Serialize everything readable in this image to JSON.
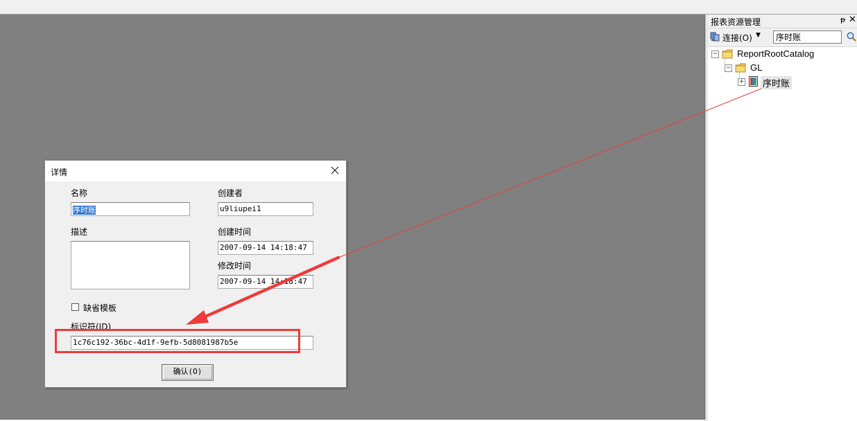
{
  "panel": {
    "title": "报表资源管理",
    "pin_glyph": "ᵽ",
    "close_glyph": "✕",
    "connect_label": "连接(O)",
    "search_value": "序时账",
    "tree": {
      "root": "ReportRootCatalog",
      "folder": "GL",
      "report": "序时账"
    }
  },
  "dialog": {
    "title": "详情",
    "name_label": "名称",
    "name_value": "序时账",
    "creator_label": "创建者",
    "creator_value": "u9liupei1",
    "desc_label": "描述",
    "created_label": "创建时间",
    "created_value": "2007-09-14 14:18:47",
    "modified_label": "修改时间",
    "modified_value": "2007-09-14 14:18:47",
    "default_template_label": "缺省模板",
    "id_label": "标识符(ID)",
    "id_value": "1c76c192-36bc-4d1f-9efb-5d8081987b5e",
    "confirm_label": "确认(O)"
  },
  "colors": {
    "workspace": "#808080",
    "annotation": "#ee3b3b",
    "selection": "#3077d0"
  },
  "icons": [
    "pin-icon",
    "close-icon",
    "connect-icon",
    "chevron-down-icon",
    "search-icon",
    "folder-icon",
    "report-icon",
    "checkbox"
  ]
}
